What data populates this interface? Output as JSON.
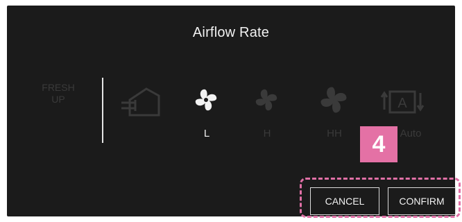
{
  "dialog": {
    "title": "Airflow Rate"
  },
  "options": {
    "fresh_up": "FRESH\nUP",
    "low": "L",
    "high": "H",
    "high_high": "HH",
    "auto": "Auto"
  },
  "callout": {
    "number": "4"
  },
  "buttons": {
    "cancel": "CANCEL",
    "confirm": "CONFIRM"
  },
  "colors": {
    "background": "#1b1b1b",
    "active": "#f2f2f2",
    "inactive": "#3a3a3a",
    "callout": "#e471a5"
  },
  "icons": [
    "house-airflow-icon",
    "fan-icon",
    "fan-icon",
    "fan-icon",
    "auto-icon"
  ]
}
